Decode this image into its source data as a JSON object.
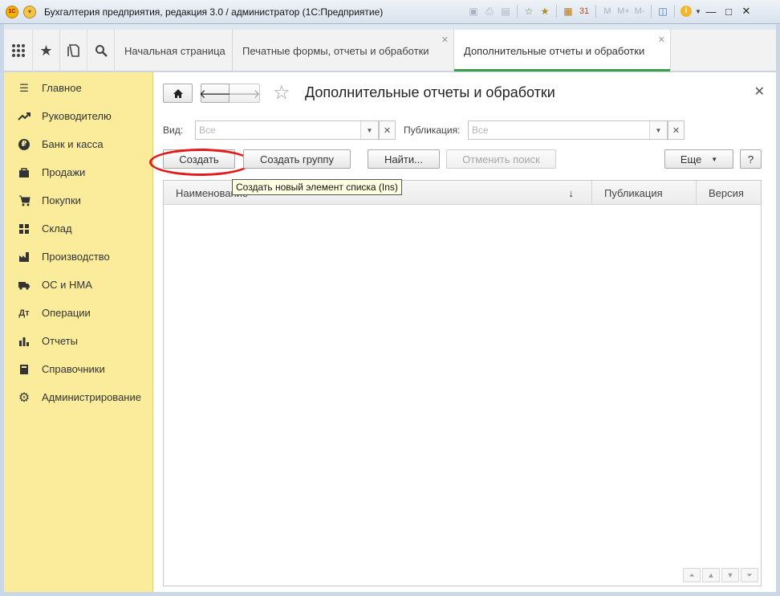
{
  "window": {
    "title": "Бухгалтерия предприятия, редакция 3.0 / администратор  (1С:Предприятие)",
    "toolbar": {
      "m_label": "M",
      "mplus_label": "M+",
      "mminus_label": "M-",
      "calendar_day": "31",
      "info_label": "i"
    },
    "controls": {
      "minimize": "—",
      "maximize": "□",
      "close": "✕"
    }
  },
  "tabs": [
    {
      "label": "Начальная страница",
      "closable": false,
      "active": false
    },
    {
      "label": "Печатные формы, отчеты и обработки",
      "closable": true,
      "active": false
    },
    {
      "label": "Дополнительные отчеты и обработки",
      "closable": true,
      "active": true
    }
  ],
  "sidebar": {
    "items": [
      {
        "label": "Главное",
        "icon": "menu-lines-icon"
      },
      {
        "label": "Руководителю",
        "icon": "trend-icon"
      },
      {
        "label": "Банк и касса",
        "icon": "ruble-icon"
      },
      {
        "label": "Продажи",
        "icon": "bag-icon"
      },
      {
        "label": "Покупки",
        "icon": "cart-icon"
      },
      {
        "label": "Склад",
        "icon": "warehouse-icon"
      },
      {
        "label": "Производство",
        "icon": "factory-icon"
      },
      {
        "label": "ОС и НМА",
        "icon": "truck-icon"
      },
      {
        "label": "Операции",
        "icon": "operations-icon"
      },
      {
        "label": "Отчеты",
        "icon": "bar-chart-icon"
      },
      {
        "label": "Справочники",
        "icon": "books-icon"
      },
      {
        "label": "Администрирование",
        "icon": "gear-icon"
      }
    ]
  },
  "form": {
    "title": "Дополнительные отчеты и обработки",
    "filter": {
      "kind_label": "Вид:",
      "kind_placeholder": "Все",
      "publication_label": "Публикация:",
      "publication_placeholder": "Все"
    },
    "buttons": {
      "create": "Создать",
      "create_group": "Создать группу",
      "find": "Найти...",
      "cancel_search": "Отменить поиск",
      "more": "Еще",
      "help": "?"
    },
    "tooltip": "Создать новый элемент списка (Ins)",
    "table": {
      "columns": [
        "Наименование",
        "Публикация",
        "Версия"
      ],
      "rows": []
    }
  },
  "colors": {
    "sidebar_bg": "#fbec9b",
    "active_tab_underline": "#3b9c4c",
    "highlight_ring": "#e01c1c",
    "tooltip_bg": "#ffffe1"
  }
}
